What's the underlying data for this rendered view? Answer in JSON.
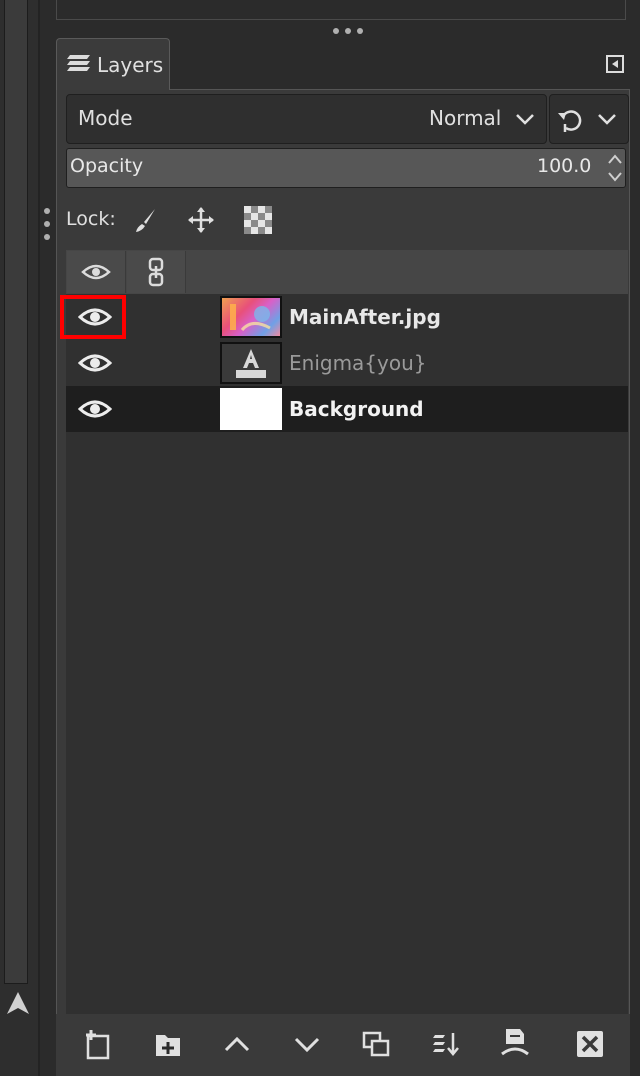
{
  "dock": {
    "tab_label": "Layers",
    "mode": {
      "label": "Mode",
      "value": "Normal"
    },
    "opacity": {
      "label": "Opacity",
      "value": "100.0"
    },
    "lock": {
      "label": "Lock:",
      "icons": [
        "paintbrush-icon",
        "move-icon",
        "checkerboard-icon"
      ]
    },
    "list_header": {
      "icons": [
        "eye-icon",
        "chain-icon"
      ]
    },
    "layers": [
      {
        "name": "MainAfter.jpg",
        "visible": true,
        "thumbnail": "photo",
        "style": "bold"
      },
      {
        "name": "Enigma{you}",
        "visible": true,
        "thumbnail": "text-layer",
        "style": "dim"
      },
      {
        "name": "Background",
        "visible": true,
        "thumbnail": "white",
        "style": "bold-selected"
      }
    ],
    "toolbar": {
      "icons": [
        "new-layer-icon",
        "new-layer-group-icon",
        "raise-layer-icon",
        "lower-layer-icon",
        "duplicate-layer-icon",
        "merge-layer-icon",
        "anchor-layer-icon",
        "delete-layer-icon"
      ]
    }
  },
  "colors": {
    "panel_bg": "#3a3a3a",
    "list_bg": "#303030",
    "selected_row": "#1e1e1e",
    "highlight": "#ff0000"
  }
}
